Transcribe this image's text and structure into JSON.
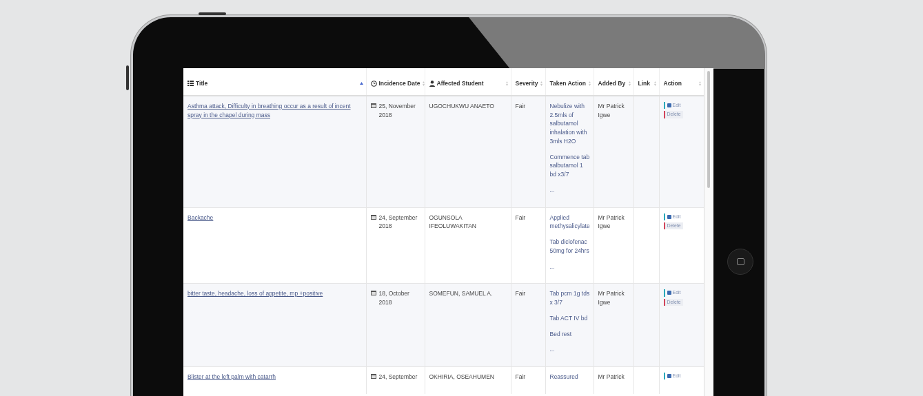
{
  "table": {
    "columns": [
      {
        "label": "Title",
        "sorted": true
      },
      {
        "label": "Incidence Date",
        "sorted": false
      },
      {
        "label": "Affected Student",
        "sorted": false
      },
      {
        "label": "Severity",
        "sorted": false
      },
      {
        "label": "Taken Action",
        "sorted": false
      },
      {
        "label": "Added By",
        "sorted": false
      },
      {
        "label": "Link",
        "sorted": false
      },
      {
        "label": "Action",
        "sorted": false
      }
    ],
    "rows": [
      {
        "title": "Asthma attack, Difficulty in breathing occur as a result of incent spray in the chapel during mass",
        "date": "25, November 2018",
        "student": "UGOCHUKWU ANAETO",
        "severity": "Fair",
        "action": [
          "Nebulize with 2.5mls of salbutamol inhalation with 3mls H2O",
          "Commence tab salbutamol 1 bd x3/7",
          "..."
        ],
        "added_by": "Mr Patrick Igwe",
        "buttons": [
          {
            "kind": "edit",
            "label": "Edit"
          },
          {
            "kind": "delete",
            "label": "Delete"
          }
        ]
      },
      {
        "title": "Backache",
        "date": "24, September 2018",
        "student": "OGUNSOLA IFEOLUWAKITAN",
        "severity": "Fair",
        "action": [
          "Applied methysalicylate",
          "Tab diclofenac 50mg for 24hrs",
          "..."
        ],
        "added_by": "Mr Patrick Igwe",
        "buttons": [
          {
            "kind": "edit",
            "label": "Edit"
          },
          {
            "kind": "delete",
            "label": "Delete"
          }
        ]
      },
      {
        "title": "bitter taste, headache, loss of appetite, mp +positive",
        "date": "18, October 2018",
        "student": "SOMEFUN, SAMUEL A.",
        "severity": "Fair",
        "action": [
          "Tab pcm 1g tds x 3/7",
          "Tab ACT IV bd",
          "Bed rest",
          "..."
        ],
        "added_by": "Mr Patrick Igwe",
        "buttons": [
          {
            "kind": "edit",
            "label": "Edit"
          },
          {
            "kind": "delete",
            "label": "Delete"
          }
        ]
      },
      {
        "title": "Blister at the left palm with catarrh",
        "date": "24, September",
        "student": "OKHIRIA, OSEAHUMEN",
        "severity": "Fair",
        "action": [
          "Reassured"
        ],
        "added_by": "Mr Patrick",
        "buttons": [
          {
            "kind": "edit",
            "label": "Edit"
          }
        ]
      }
    ]
  }
}
